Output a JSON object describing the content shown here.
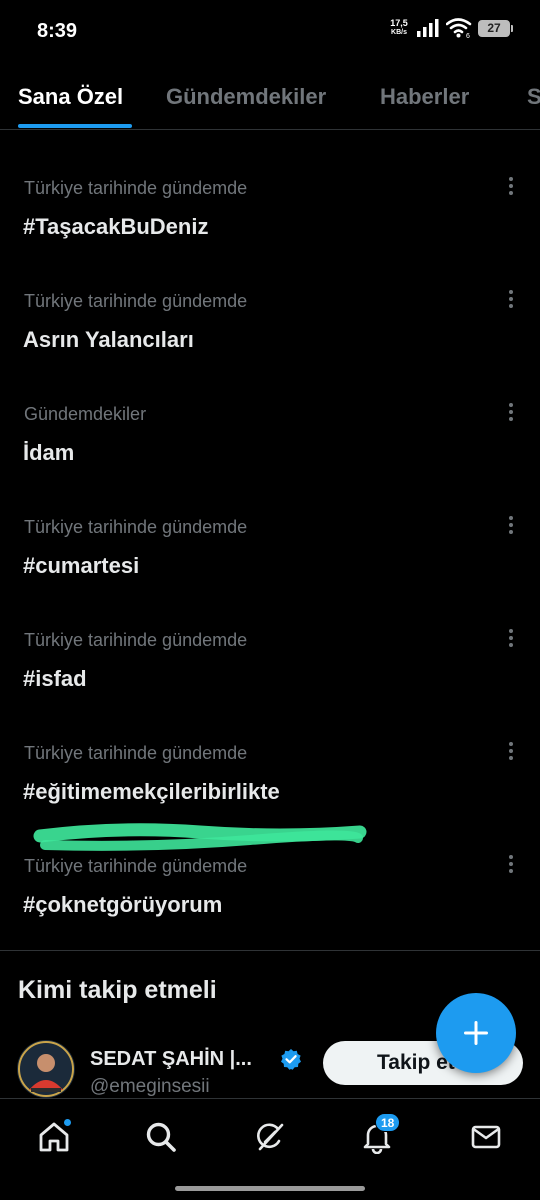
{
  "status_bar": {
    "time": "8:39",
    "net_speed_value": "17,5",
    "net_speed_unit": "KB/s",
    "battery": "27"
  },
  "tabs": [
    {
      "label": "Sana Özel",
      "active": true
    },
    {
      "label": "Gündemdekiler",
      "active": false
    },
    {
      "label": "Haberler",
      "active": false
    },
    {
      "label": "S",
      "active": false
    }
  ],
  "trends": [
    {
      "meta": "Türkiye tarihinde gündemde",
      "title": "#TaşacakBuDeniz"
    },
    {
      "meta": "Türkiye tarihinde gündemde",
      "title": "Asrın Yalancıları"
    },
    {
      "meta": "Gündemdekiler",
      "title": "İdam"
    },
    {
      "meta": "Türkiye tarihinde gündemde",
      "title": "#cumartesi"
    },
    {
      "meta": "Türkiye tarihinde gündemde",
      "title": "#isfad"
    },
    {
      "meta": "Türkiye tarihinde gündemde",
      "title": "#eğitimemekçileribirlikte"
    },
    {
      "meta": "Türkiye tarihinde gündemde",
      "title": "#çoknetgörüyorum"
    }
  ],
  "who_to_follow": {
    "title": "Kimi takip etmeli",
    "user": {
      "name": "SEDAT ŞAHİN |...",
      "handle": "@emeginsesii",
      "follow_label": "Takip et"
    }
  },
  "bottom_nav": {
    "notifications_badge": "18"
  },
  "colors": {
    "accent": "#1d9bf0",
    "highlight_stroke": "#3ee69a",
    "background": "#000000",
    "muted_text": "#71767b"
  }
}
